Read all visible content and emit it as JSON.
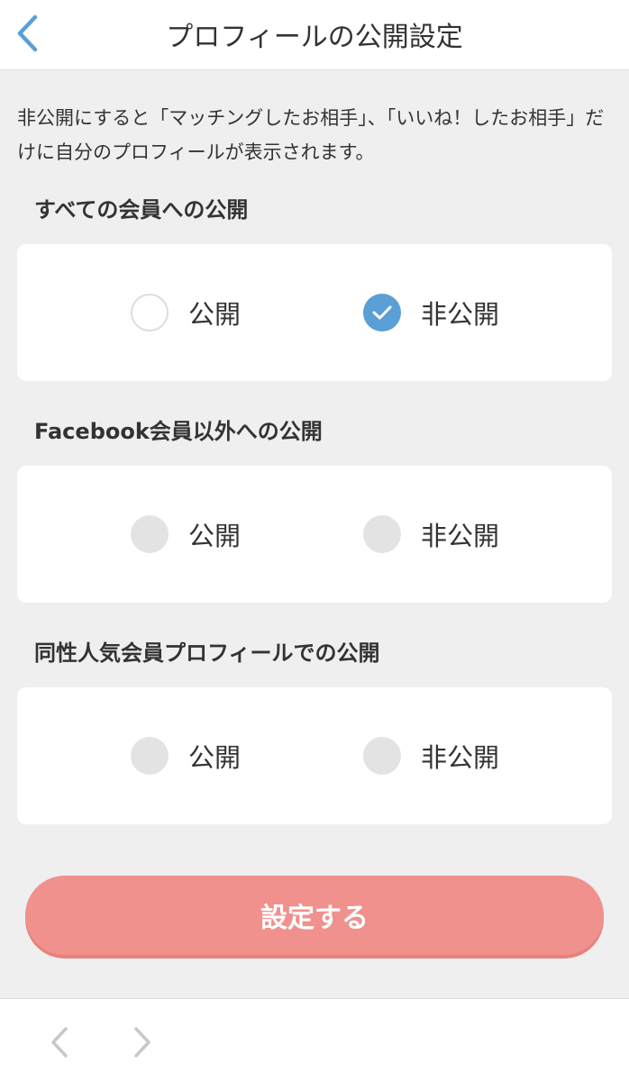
{
  "header": {
    "title": "プロフィールの公開設定",
    "back_icon": "chevron-left-icon",
    "accent_color": "#5a9fd6"
  },
  "description": "非公開にすると「マッチングしたお相手」、「いいね！したお相手」だけに自分のプロフィールが表示されます。",
  "sections": [
    {
      "heading": "すべての会員への公開",
      "options": [
        {
          "label": "公開",
          "selected": false
        },
        {
          "label": "非公開",
          "selected": true
        }
      ]
    },
    {
      "heading": "Facebook会員以外への公開",
      "options": [
        {
          "label": "公開",
          "selected": false
        },
        {
          "label": "非公開",
          "selected": false
        }
      ]
    },
    {
      "heading": "同性人気会員プロフィールでの公開",
      "options": [
        {
          "label": "公開",
          "selected": false
        },
        {
          "label": "非公開",
          "selected": false
        }
      ]
    }
  ],
  "submit": {
    "label": "設定する",
    "color": "#f0918d"
  },
  "bottom_nav": {
    "back_icon": "chevron-left-icon",
    "forward_icon": "chevron-right-icon"
  }
}
